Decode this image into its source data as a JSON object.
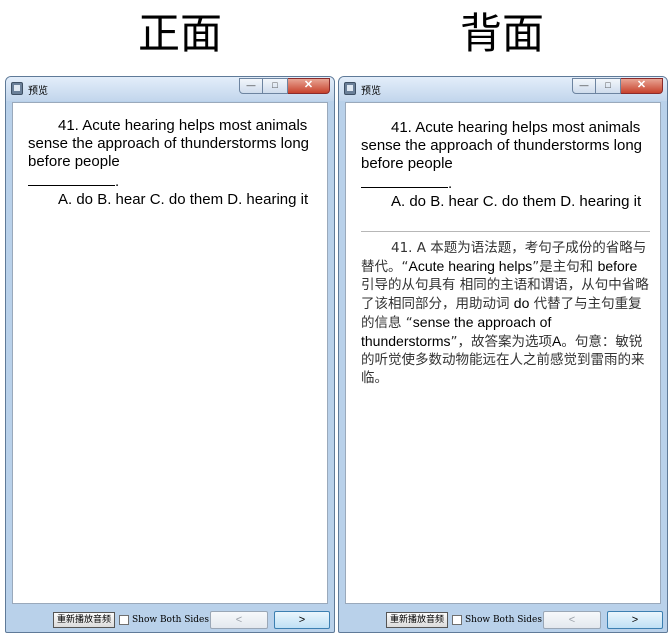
{
  "headings": {
    "front": "正面",
    "back": "背面"
  },
  "window": {
    "title": "预览",
    "minimize_glyph": "—",
    "maximize_glyph": "□",
    "close_glyph": "✕"
  },
  "question": {
    "stem": "41. Acute hearing helps most animals sense the approach of thunderstorms long before people",
    "blank_suffix": ".",
    "options": "A. do B. hear C. do them D. hearing it"
  },
  "answer": {
    "part1": "41. A 本题为语法题，考句子成份的省略与替代。“",
    "quote1": "Acute hearing helps",
    "part2": "”是主句和 ",
    "word_before": "before",
    "part3": " 引导的从句具有 相同的主语和谓语，从句中省略了该相同部分，用助动词 ",
    "word_do": "do",
    "part4": " 代替了与主句重复的信息 “",
    "quote2": "sense the approach of thunderstorms",
    "part5": "”，故答案为选项",
    "letter": "A",
    "part6": "。句意：敏锐的听觉使多数动物能远在人之前感觉到雷雨的来 临。"
  },
  "controls": {
    "replay_label": "重新播放音频",
    "show_both_sides_label": "Show Both Sides",
    "show_both_sides_checked": false,
    "prev_glyph": "<",
    "next_glyph": ">"
  }
}
